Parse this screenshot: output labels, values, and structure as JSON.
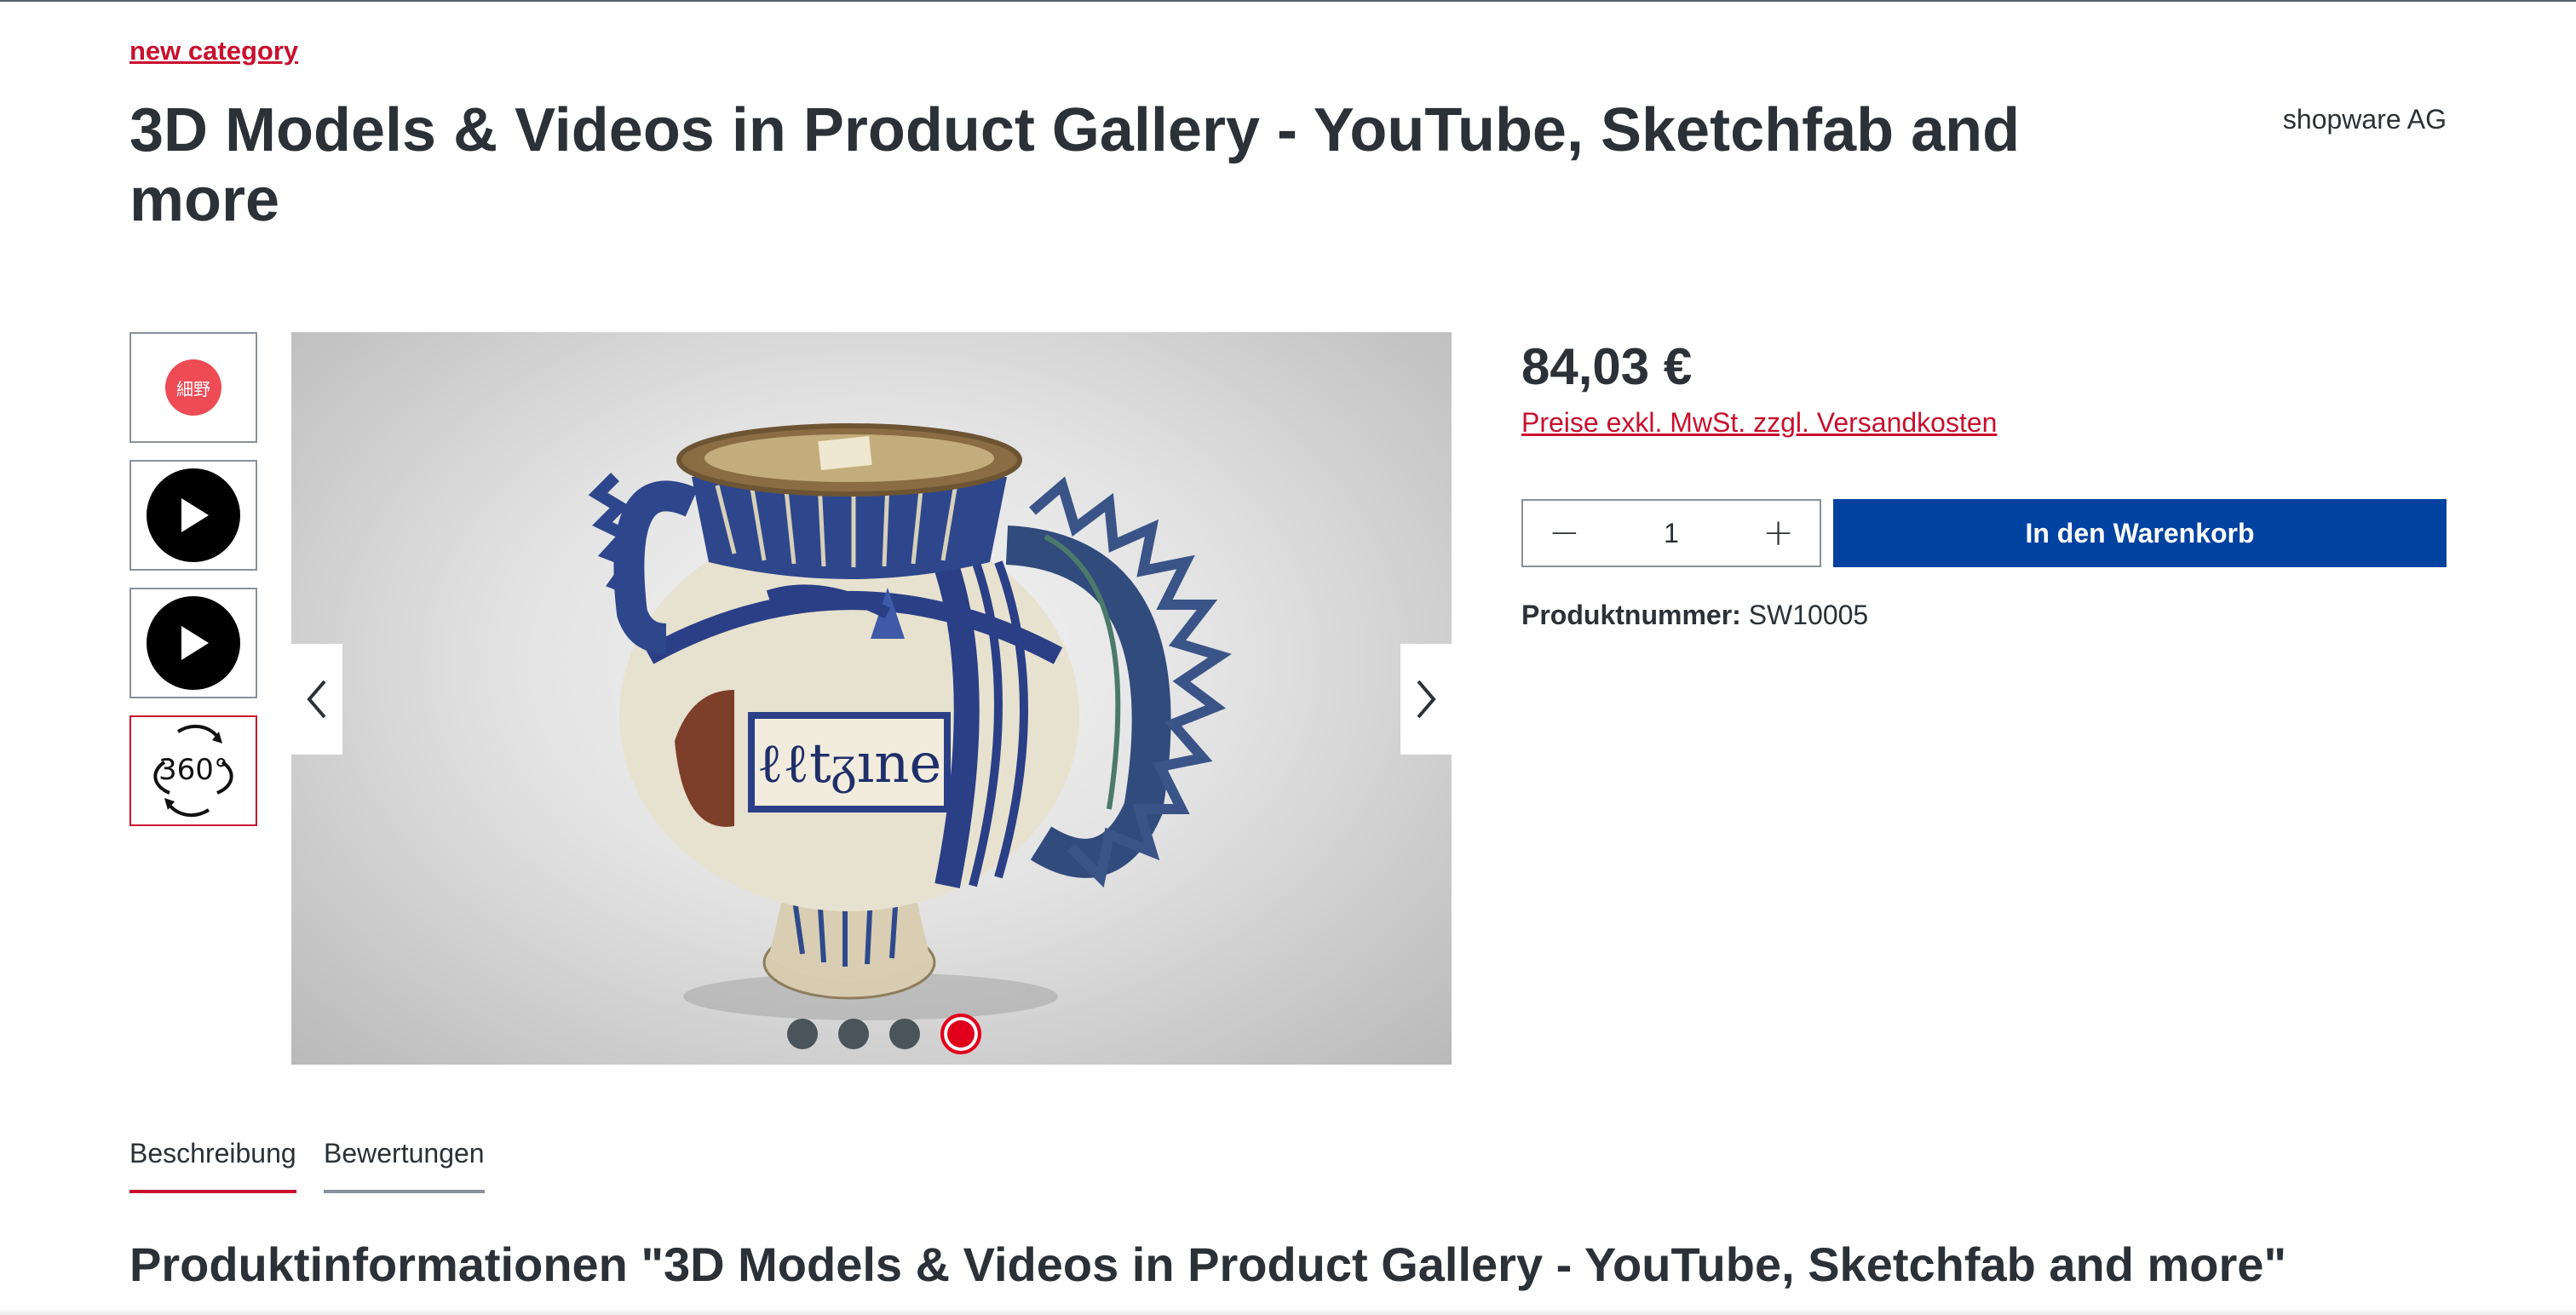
{
  "breadcrumb": {
    "label": "new category"
  },
  "product": {
    "title": "3D Models & Videos in Product Gallery - YouTube, Sketchfab and more",
    "manufacturer": "shopware AG",
    "price": "84,03 €",
    "tax_note": "Preise exkl. MwSt. zzgl. Versandkosten",
    "product_number_label": "Produktnummer:",
    "product_number": "SW10005"
  },
  "gallery": {
    "thumbnails": [
      {
        "type": "logo",
        "text": "細野",
        "icon": "brand-logo-icon"
      },
      {
        "type": "video",
        "icon": "play-icon"
      },
      {
        "type": "video",
        "icon": "play-icon"
      },
      {
        "type": "3d",
        "text": "360°",
        "icon": "360-view-icon",
        "active": true
      }
    ],
    "prev_icon": "chevron-left-icon",
    "next_icon": "chevron-right-icon",
    "slide_count": 4,
    "active_slide": 4
  },
  "buy_box": {
    "quantity": "1",
    "minus_icon": "minus-icon",
    "plus_icon": "plus-icon",
    "add_to_cart_label": "In den Warenkorb"
  },
  "tabs": [
    {
      "label": "Beschreibung",
      "active": true
    },
    {
      "label": "Bewertungen",
      "active": false
    }
  ],
  "description": {
    "heading": "Produktinformationen \"3D Models & Videos in Product Gallery - YouTube, Sketchfab and more\""
  },
  "colors": {
    "accent_red": "#c8102e",
    "button_blue": "#0042a0",
    "text_dark": "#2b3136"
  }
}
